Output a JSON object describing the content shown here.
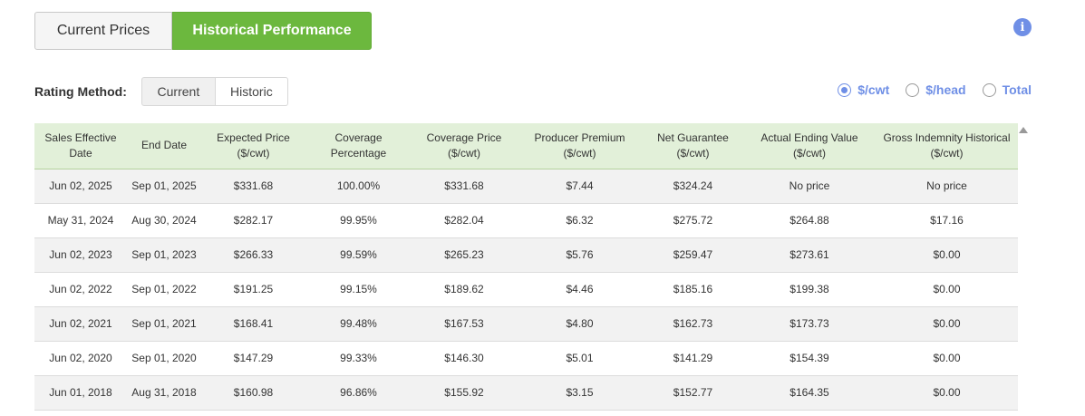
{
  "tabs": {
    "current_prices": "Current Prices",
    "historical_performance": "Historical Performance"
  },
  "info_icon": "info-icon",
  "rating": {
    "label": "Rating Method:",
    "options": [
      "Current",
      "Historic"
    ],
    "selected": "Current"
  },
  "units": {
    "options": [
      "$/cwt",
      "$/head",
      "Total"
    ],
    "selected": "$/cwt"
  },
  "colors": {
    "accent_green": "#6cb83e",
    "accent_blue": "#6f8fe6",
    "header_bg": "#e2f0d9"
  },
  "table": {
    "headers": [
      "Sales Effective Date",
      "End Date",
      "Expected Price ($/cwt)",
      "Coverage Percentage",
      "Coverage Price ($/cwt)",
      "Producer Premium ($/cwt)",
      "Net Guarantee ($/cwt)",
      "Actual Ending Value ($/cwt)",
      "Gross Indemnity Historical ($/cwt)"
    ],
    "rows": [
      [
        "Jun 02, 2025",
        "Sep 01, 2025",
        "$331.68",
        "100.00%",
        "$331.68",
        "$7.44",
        "$324.24",
        "No price",
        "No price"
      ],
      [
        "May 31, 2024",
        "Aug 30, 2024",
        "$282.17",
        "99.95%",
        "$282.04",
        "$6.32",
        "$275.72",
        "$264.88",
        "$17.16"
      ],
      [
        "Jun 02, 2023",
        "Sep 01, 2023",
        "$266.33",
        "99.59%",
        "$265.23",
        "$5.76",
        "$259.47",
        "$273.61",
        "$0.00"
      ],
      [
        "Jun 02, 2022",
        "Sep 01, 2022",
        "$191.25",
        "99.15%",
        "$189.62",
        "$4.46",
        "$185.16",
        "$199.38",
        "$0.00"
      ],
      [
        "Jun 02, 2021",
        "Sep 01, 2021",
        "$168.41",
        "99.48%",
        "$167.53",
        "$4.80",
        "$162.73",
        "$173.73",
        "$0.00"
      ],
      [
        "Jun 02, 2020",
        "Sep 01, 2020",
        "$147.29",
        "99.33%",
        "$146.30",
        "$5.01",
        "$141.29",
        "$154.39",
        "$0.00"
      ],
      [
        "Jun 01, 2018",
        "Aug 31, 2018",
        "$160.98",
        "96.86%",
        "$155.92",
        "$3.15",
        "$152.77",
        "$164.35",
        "$0.00"
      ]
    ]
  }
}
